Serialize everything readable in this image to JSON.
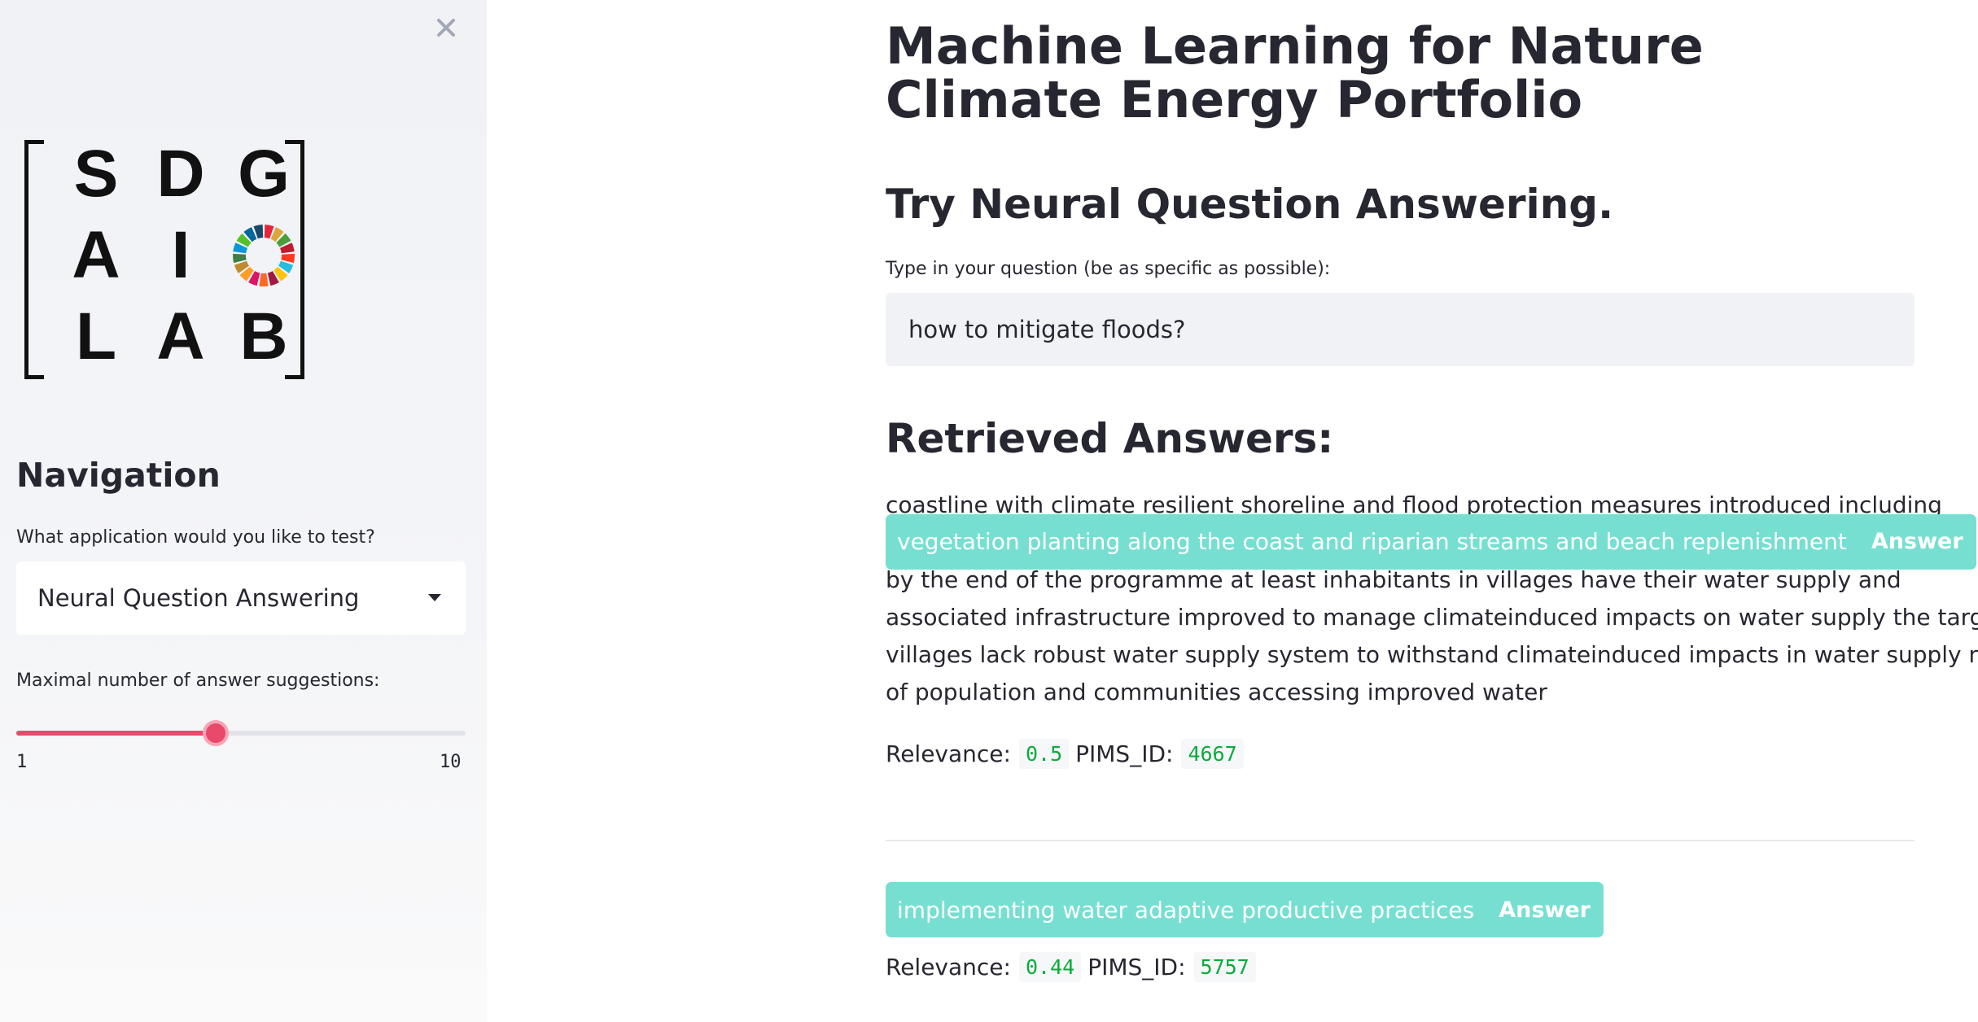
{
  "sidebar": {
    "logo": {
      "letters": [
        "S",
        "D",
        "G",
        "A",
        "I",
        "L",
        "A",
        "B"
      ],
      "wheel_colors": [
        "#e5243b",
        "#dda63a",
        "#4c9f38",
        "#c5192d",
        "#ff3a21",
        "#26bde2",
        "#fcc30b",
        "#a21942",
        "#fd6925",
        "#dd1367",
        "#fd9d24",
        "#bf8b2e",
        "#3f7e44",
        "#0a97d9",
        "#56c02b",
        "#00689d",
        "#19486a"
      ]
    },
    "close_icon": "close-icon",
    "nav_title": "Navigation",
    "app_question": "What application would you like to test?",
    "app_select": {
      "value": "Neural Question Answering",
      "icon": "chevron-down-icon"
    },
    "slider": {
      "label": "Maximal number of answer suggestions:",
      "min": "1",
      "max": "10",
      "value": 5,
      "accent": "#e84a6b"
    }
  },
  "main": {
    "title": "Machine Learning for Nature Climate Energy Portfolio",
    "subtitle": "Try Neural Question Answering.",
    "question_label": "Type in your question (be as specific as possible):",
    "question_value": "how to mitigate floods?",
    "answers_title": "Retrieved Answers:",
    "answers": [
      {
        "context_before": "coastline with climate resilient shoreline and flood protection measures introduced including",
        "answer": "vegetation planting along the coast and riparian streams and beach replenishment",
        "answer_tag": "Answer",
        "context_after": [
          "by the end of the programme at least inhabitants in villages have their water supply and",
          "associated infrastructure improved to manage climateinduced impacts on water supply the target",
          "villages lack robust water supply system to withstand climateinduced impacts in water supply n",
          "of population and communities accessing improved water"
        ],
        "relevance_label": "Relevance:",
        "relevance": "0.5",
        "pims_label": "PIMS_ID:",
        "pims_id": "4667"
      },
      {
        "answer": "implementing water adaptive productive practices",
        "answer_tag": "Answer",
        "relevance_label": "Relevance:",
        "relevance": "0.44",
        "pims_label": "PIMS_ID:",
        "pims_id": "5757"
      }
    ],
    "colors": {
      "answer_chip": "#76dfd1",
      "code_text": "#09ab3b"
    }
  }
}
